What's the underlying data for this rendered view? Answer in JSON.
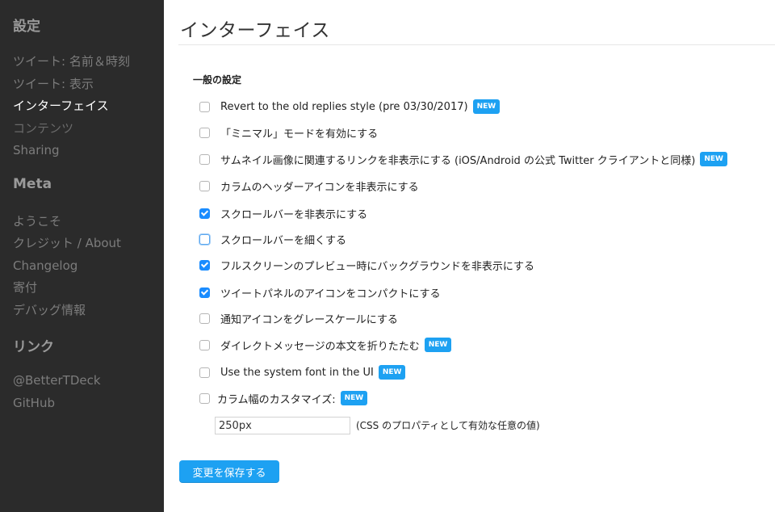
{
  "sidebar": {
    "heading_settings": "設定",
    "settings_items": [
      {
        "label": "ツイート: 名前＆時刻",
        "active": false
      },
      {
        "label": "ツイート: 表示",
        "active": false
      },
      {
        "label": "インターフェイス",
        "active": true
      },
      {
        "label": "コンテンツ",
        "active": false
      },
      {
        "label": "Sharing",
        "active": false
      }
    ],
    "heading_meta": "Meta",
    "meta_items": [
      {
        "label": "ようこそ"
      },
      {
        "label": "クレジット / About"
      },
      {
        "label": "Changelog"
      },
      {
        "label": "寄付"
      },
      {
        "label": "デバッグ情報"
      }
    ],
    "heading_links": "リンク",
    "link_items": [
      {
        "label": "@BetterTDeck"
      },
      {
        "label": "GitHub"
      }
    ]
  },
  "main": {
    "title": "インターフェイス",
    "section_title": "一般の設定",
    "badge_label": "NEW",
    "options": [
      {
        "label": "Revert to the old replies style (pre 03/30/2017)",
        "checked": false,
        "new": true
      },
      {
        "label": "「ミニマル」モードを有効にする",
        "checked": false,
        "new": false
      },
      {
        "label": "サムネイル画像に関連するリンクを非表示にする (iOS/Android の公式 Twitter クライアントと同様)",
        "checked": false,
        "new": true
      },
      {
        "label": "カラムのヘッダーアイコンを非表示にする",
        "checked": false,
        "new": false
      },
      {
        "label": "スクロールバーを非表示にする",
        "checked": true,
        "new": false
      },
      {
        "label": "スクロールバーを細くする",
        "checked": false,
        "new": false
      },
      {
        "label": "フルスクリーンのプレビュー時にバックグラウンドを非表示にする",
        "checked": true,
        "new": false
      },
      {
        "label": "ツイートパネルのアイコンをコンパクトにする",
        "checked": true,
        "new": false
      },
      {
        "label": "通知アイコンをグレースケールにする",
        "checked": false,
        "new": false
      },
      {
        "label": "ダイレクトメッセージの本文を折りたたむ",
        "checked": false,
        "new": true
      },
      {
        "label": "Use the system font in the UI",
        "checked": false,
        "new": true
      },
      {
        "label": "カラム幅のカスタマイズ:",
        "checked": false,
        "new": true
      }
    ],
    "column_width_value": "250px",
    "column_width_hint": "(CSS のプロパティとして有効な任意の値)",
    "save_label": "変更を保存する"
  }
}
